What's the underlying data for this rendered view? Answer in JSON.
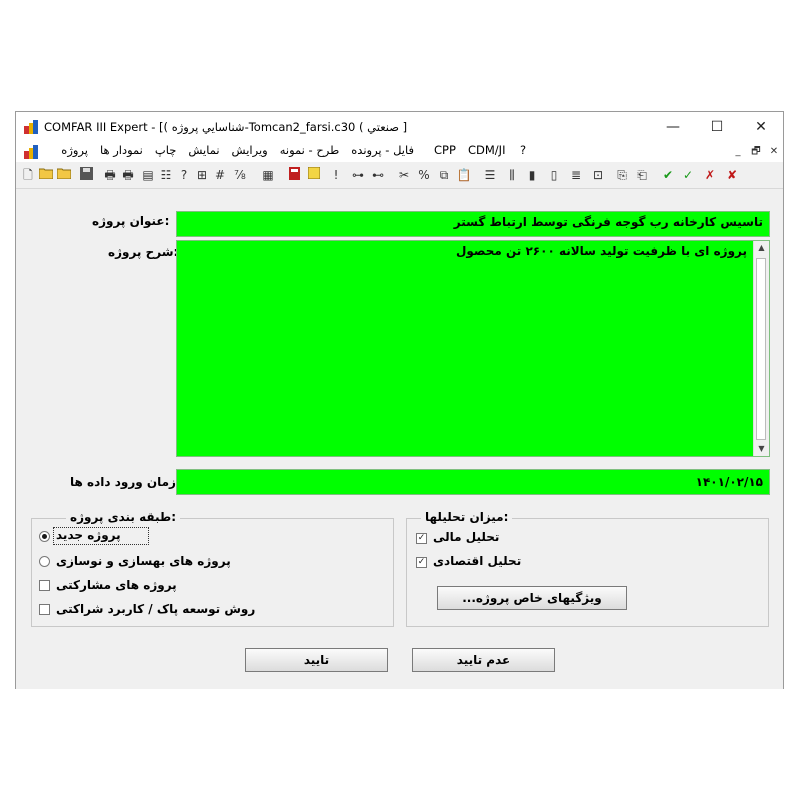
{
  "window": {
    "title": "COMFAR III Expert - [( شناسايي پروژه-Tomcan2_farsi.c30 ( صنعتي ]",
    "controls": {
      "minimize": "—",
      "maximize": "☐",
      "close": "✕"
    }
  },
  "menubar": {
    "items": [
      "فایل - پرونده",
      "طرح - نمونه",
      "ویرایش",
      "نمایش",
      "چاپ",
      "نمودار ها",
      "پروژه"
    ],
    "cpp": "CPP",
    "cdm": "CDM/JI",
    "help": "?",
    "mdi": {
      "minimize": "_",
      "restore": "🗗",
      "close": "✕"
    }
  },
  "form": {
    "title_label": ":عنوان پروژه",
    "title_value": "تاسیس کارخانه رب گوجه فرنگی توسط ارتباط گستر",
    "desc_label": ":شرح پروژه",
    "desc_value": "پروژه ای با ظرفیت تولید سالانه ۲۶۰۰ تن محصول",
    "date_label": ":زمان ورود داده ها",
    "date_value": "۱۴۰۱/۰۲/۱۵"
  },
  "classification": {
    "title": ":طبقه بندی پروژه",
    "options": [
      {
        "label": "پروژه جدید",
        "selected": true
      },
      {
        "label": "پروژه های بهسازی و نوسازی",
        "selected": false
      },
      {
        "label": "پروژه های مشارکتی",
        "selected": false
      },
      {
        "label": "روش توسعه پاک / کاربرد شراکتی",
        "selected": false
      }
    ]
  },
  "analysis": {
    "title": ":میزان تحلیلها",
    "financial": {
      "label": "تحلیل مالی",
      "checked": true
    },
    "economic": {
      "label": "تحلیل اقتصادی",
      "checked": true
    },
    "special_button": "ویژگیهای خاص پروژه..."
  },
  "buttons": {
    "cancel": "عدم تایید",
    "ok": "تایید"
  },
  "colors": {
    "field_bg": "#00ff00",
    "window_bg": "#f0f0f0"
  }
}
